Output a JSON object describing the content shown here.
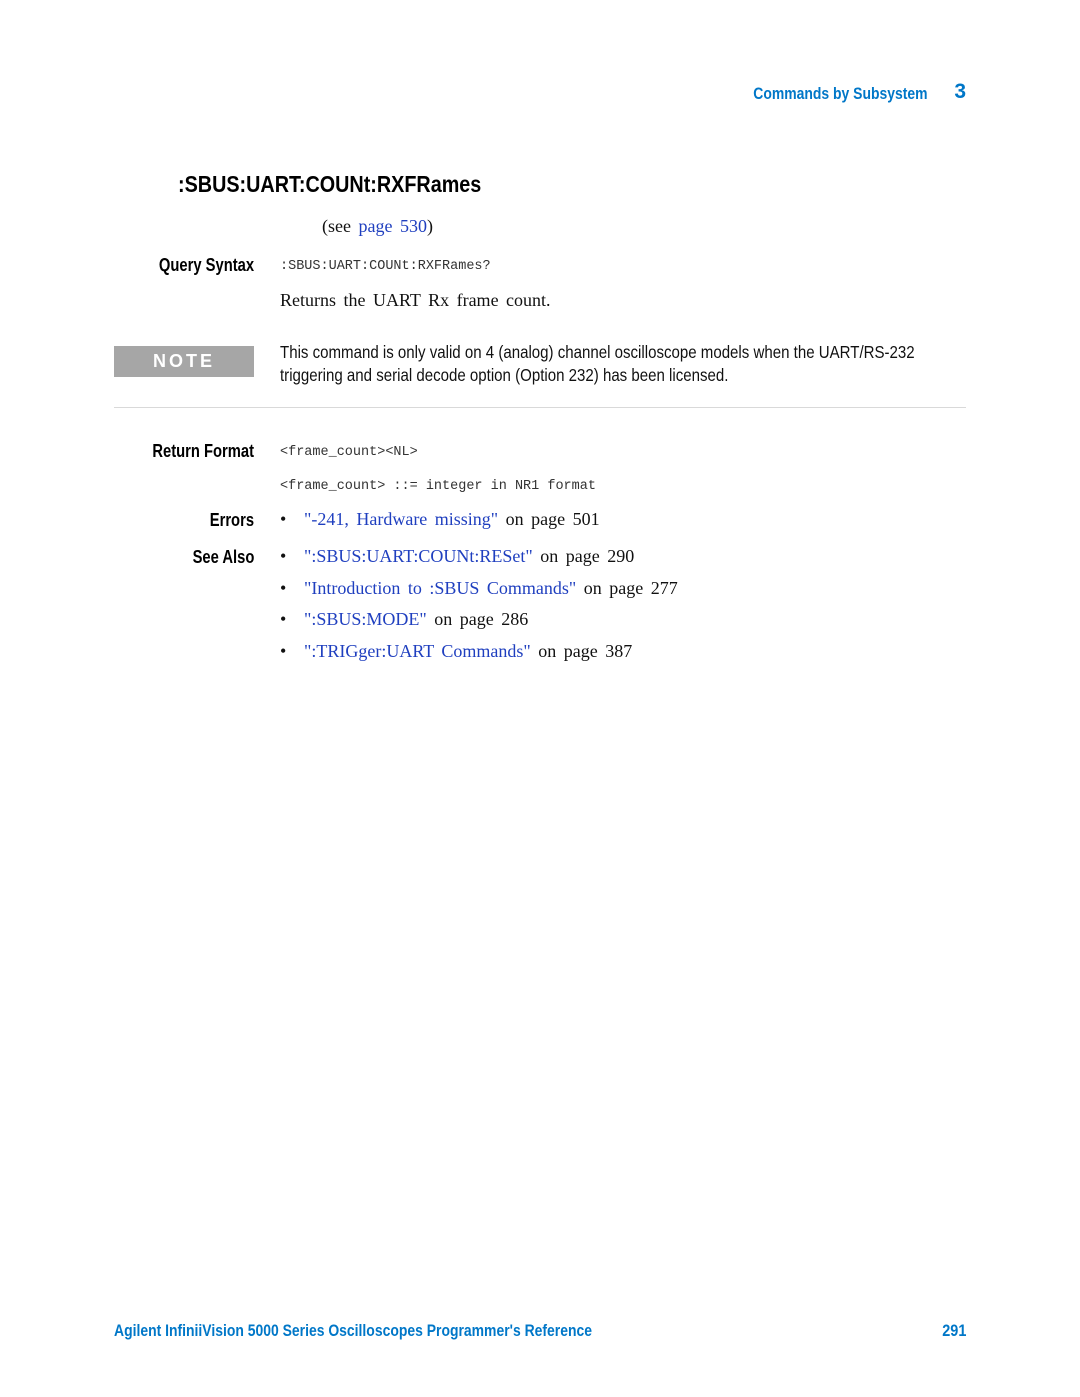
{
  "header": {
    "section": "Commands by Subsystem",
    "chapter": "3"
  },
  "title": ":SBUS:UART:COUNt:RXFRames",
  "see_ref": {
    "prefix": "(see ",
    "link_text": "page 530",
    "suffix": ")"
  },
  "query_syntax": {
    "label": "Query Syntax",
    "code": ":SBUS:UART:COUNt:RXFRames?",
    "description": "Returns the UART Rx frame count."
  },
  "note": {
    "badge": "NOTE",
    "text": "This command is only valid on 4 (analog) channel oscilloscope models when the UART/RS-232 triggering and serial decode option (Option 232) has been licensed."
  },
  "return_format": {
    "label": "Return Format",
    "line1": "<frame_count><NL>",
    "line2": "<frame_count> ::= integer in NR1 format"
  },
  "errors": {
    "label": "Errors",
    "items": [
      {
        "link": "\"-241, Hardware missing\"",
        "suffix": " on page 501"
      }
    ]
  },
  "see_also": {
    "label": "See Also",
    "items": [
      {
        "link": "\":SBUS:UART:COUNt:RESet\"",
        "suffix": " on page 290"
      },
      {
        "link": "\"Introduction to :SBUS Commands\"",
        "suffix": " on page 277"
      },
      {
        "link": "\":SBUS:MODE\"",
        "suffix": " on page 286"
      },
      {
        "link": "\":TRIGger:UART Commands\"",
        "suffix": " on page 387"
      }
    ]
  },
  "bullet_glyph": "•",
  "footer": {
    "title": "Agilent InfiniiVision 5000 Series Oscilloscopes Programmer's Reference",
    "page": "291"
  }
}
